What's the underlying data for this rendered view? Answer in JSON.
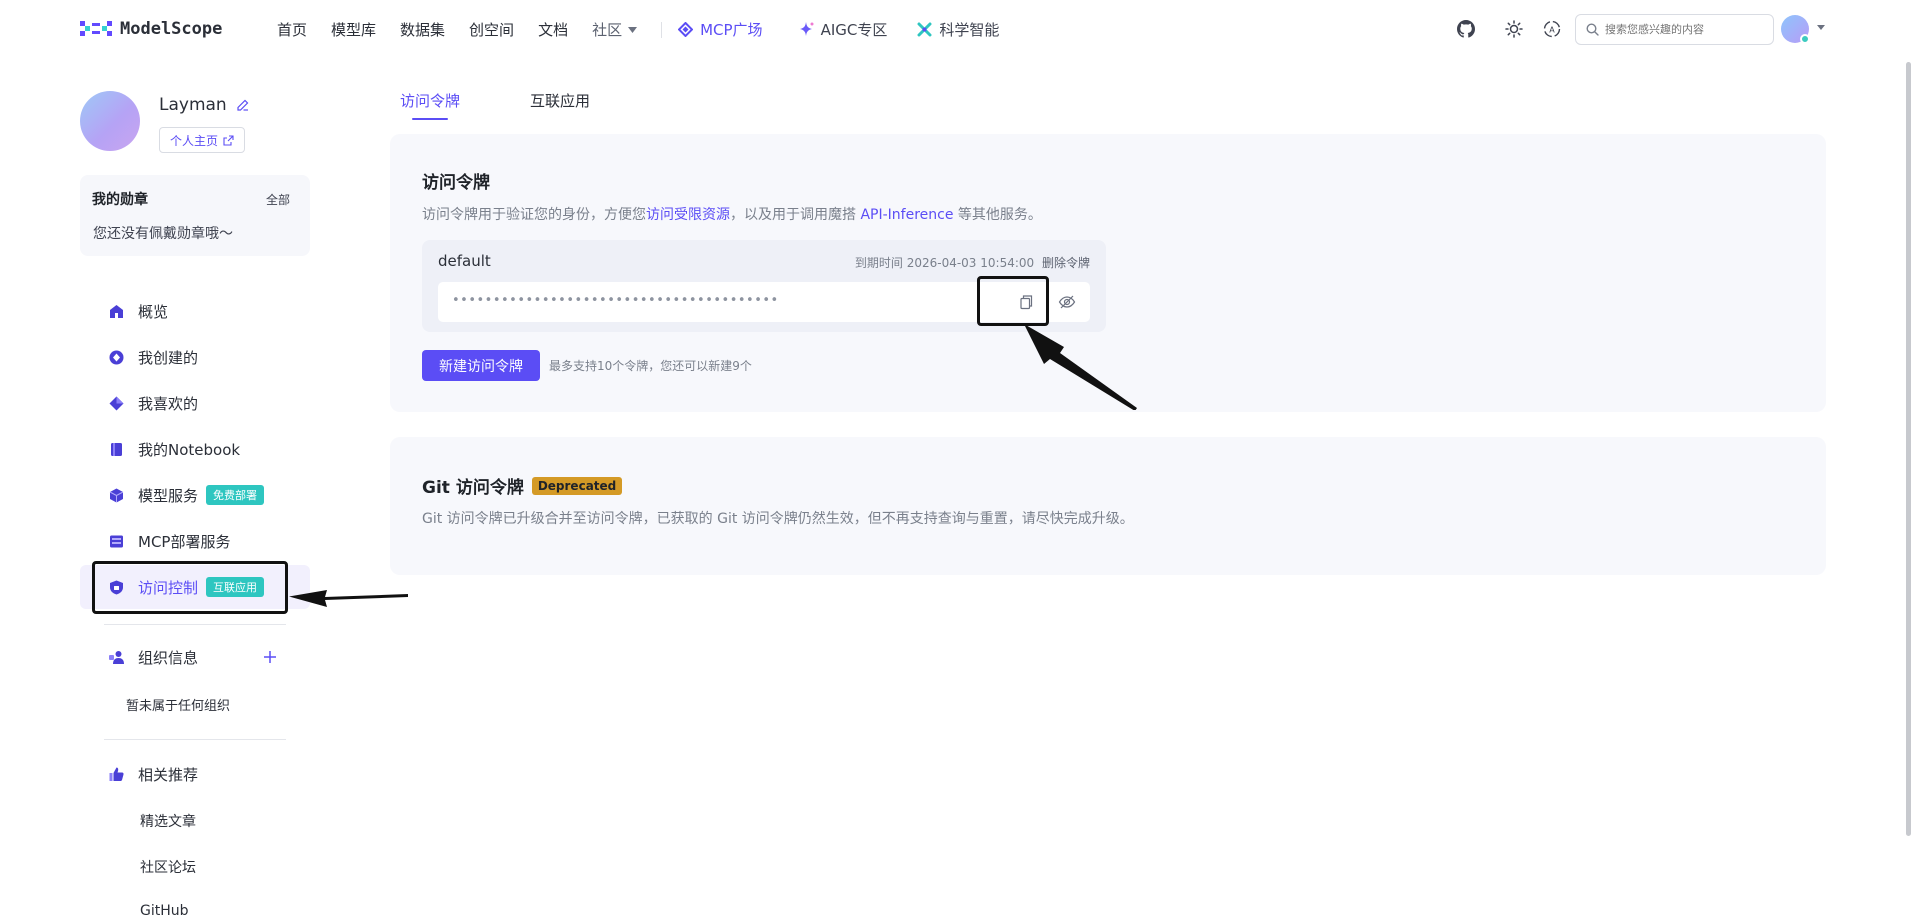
{
  "brand": {
    "name": "ModelScope"
  },
  "nav": {
    "links": [
      "首页",
      "模型库",
      "数据集",
      "创空间",
      "文档"
    ],
    "community": "社区",
    "mcp": "MCP广场",
    "aigc": "AIGC专区",
    "science": "科学智能"
  },
  "search": {
    "placeholder": "搜索您感兴趣的内容"
  },
  "profile": {
    "name": "Layman",
    "home_button": "个人主页"
  },
  "badges": {
    "title": "我的勋章",
    "all": "全部",
    "empty": "您还没有佩戴勋章哦～"
  },
  "sidebar": {
    "overview": "概览",
    "created": "我创建的",
    "liked": "我喜欢的",
    "notebook": "我的Notebook",
    "model_service": "模型服务",
    "model_service_tag": "免费部署",
    "mcp_service": "MCP部署服务",
    "access_control": "访问控制",
    "access_control_tag": "互联应用",
    "org_info": "组织信息",
    "org_empty": "暂未属于任何组织",
    "recommend": "相关推荐",
    "articles": "精选文章",
    "forum": "社区论坛",
    "github": "GitHub"
  },
  "tabs": [
    "访问令牌",
    "互联应用"
  ],
  "token_card": {
    "title": "访问令牌",
    "desc_prefix": "访问令牌用于验证您的身份，方便您",
    "desc_link1": "访问受限资源",
    "desc_middle": "，以及用于调用魔搭 ",
    "desc_link2": "API-Inference",
    "desc_suffix": " 等其他服务。",
    "token": {
      "name": "default",
      "expiry_label": "到期时间 2026-04-03 10:54:00",
      "delete": "删除令牌",
      "masked": "••••••••••••••••••••••••••••••••••••••••"
    },
    "new_button": "新建访问令牌",
    "hint": "最多支持10个令牌，您还可以新建9个"
  },
  "git_card": {
    "title": "Git 访问令牌",
    "badge": "Deprecated",
    "desc": "Git 访问令牌已升级合并至访问令牌，已获取的 Git 访问令牌仍然生效，但不再支持查询与重置，请尽快完成升级。"
  },
  "colors": {
    "accent": "#5b4df5",
    "teal": "#2ec6c0",
    "deprecated": "#d49a26"
  }
}
